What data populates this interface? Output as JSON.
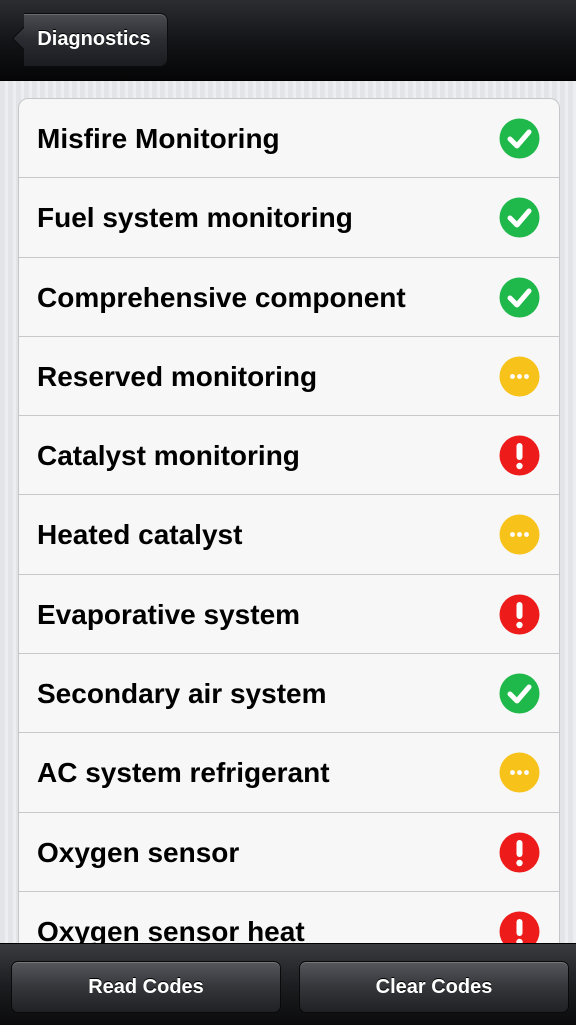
{
  "navbar": {
    "back_label": "Diagnostics"
  },
  "monitors": [
    {
      "label": "Misfire Monitoring",
      "status": "complete"
    },
    {
      "label": "Fuel system monitoring",
      "status": "complete"
    },
    {
      "label": "Comprehensive component",
      "status": "complete"
    },
    {
      "label": "Reserved monitoring",
      "status": "not-available"
    },
    {
      "label": "Catalyst monitoring",
      "status": "incomplete"
    },
    {
      "label": "Heated catalyst",
      "status": "not-available"
    },
    {
      "label": "Evaporative system",
      "status": "incomplete"
    },
    {
      "label": "Secondary air system",
      "status": "complete"
    },
    {
      "label": "AC system refrigerant",
      "status": "not-available"
    },
    {
      "label": "Oxygen sensor",
      "status": "incomplete"
    },
    {
      "label": "Oxygen sensor heat",
      "status": "incomplete"
    }
  ],
  "status_icons": {
    "complete": {
      "icon": "check-icon",
      "color": "#1fb84a"
    },
    "not-available": {
      "icon": "ellipsis-icon",
      "color": "#f7c21a"
    },
    "incomplete": {
      "icon": "exclamation-icon",
      "color": "#ee1b1b"
    }
  },
  "toolbar": {
    "read_label": "Read Codes",
    "clear_label": "Clear Codes"
  }
}
